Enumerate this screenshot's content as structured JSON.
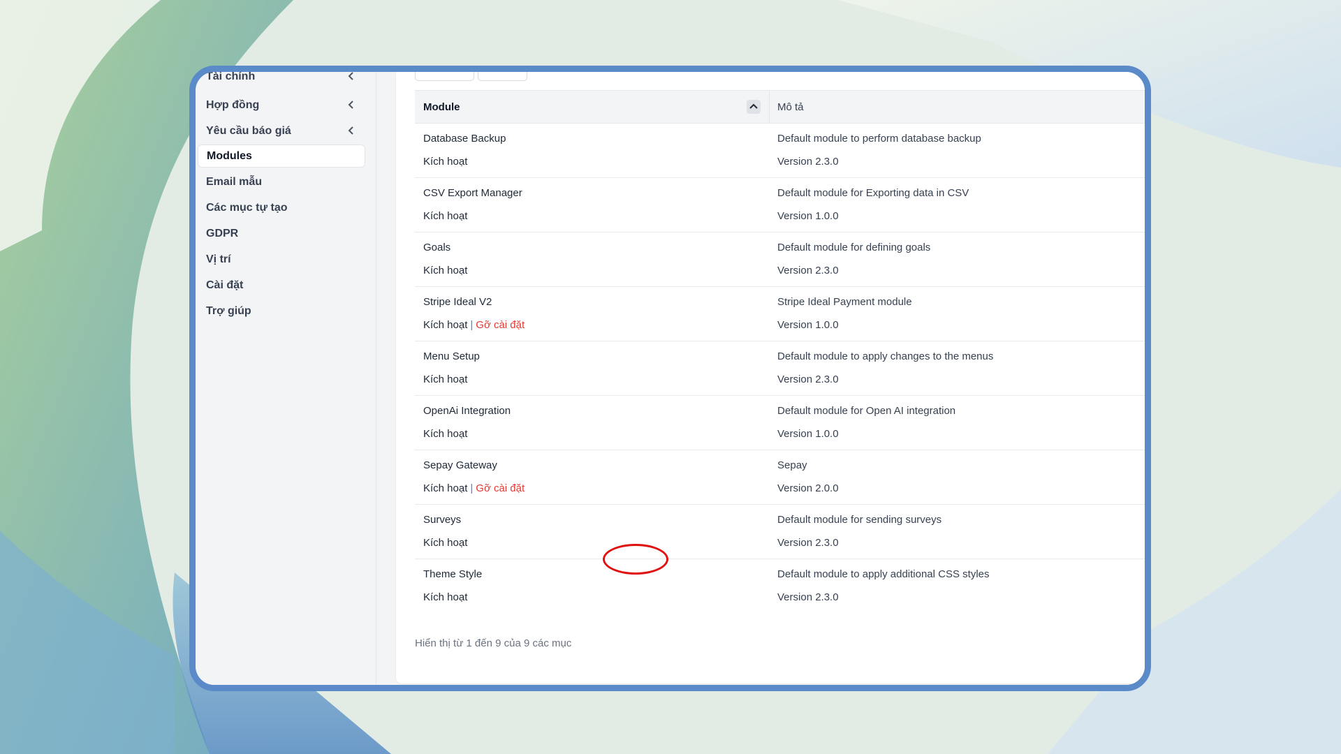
{
  "sidebar": {
    "items": [
      {
        "label": "Tài chính",
        "has_chevron": true,
        "active": false
      },
      {
        "label": "Hợp đồng",
        "has_chevron": true,
        "active": false
      },
      {
        "label": "Yêu cầu báo giá",
        "has_chevron": true,
        "active": false
      },
      {
        "label": "Modules",
        "has_chevron": false,
        "active": true
      },
      {
        "label": "Email mẫu",
        "has_chevron": false,
        "active": false
      },
      {
        "label": "Các mục tự tạo",
        "has_chevron": false,
        "active": false
      },
      {
        "label": "GDPR",
        "has_chevron": false,
        "active": false
      },
      {
        "label": "Vị trí",
        "has_chevron": false,
        "active": false
      },
      {
        "label": "Cài đặt",
        "has_chevron": false,
        "active": false
      },
      {
        "label": "Trợ giúp",
        "has_chevron": false,
        "active": false
      }
    ]
  },
  "table": {
    "headers": {
      "module": "Module",
      "description": "Mô tả"
    },
    "sort_icon": "chevron-up-icon",
    "rows": [
      {
        "name": "Database Backup",
        "activate": "Kích hoạt",
        "uninstall": "",
        "description": "Default module to perform database backup",
        "version": "Version 2.3.0"
      },
      {
        "name": "CSV Export Manager",
        "activate": "Kích hoạt",
        "uninstall": "",
        "description": "Default module for Exporting data in CSV",
        "version": "Version 1.0.0"
      },
      {
        "name": "Goals",
        "activate": "Kích hoạt",
        "uninstall": "",
        "description": "Default module for defining goals",
        "version": "Version 2.3.0"
      },
      {
        "name": "Stripe Ideal V2",
        "activate": "Kích hoạt",
        "uninstall": "Gỡ cài đặt",
        "description": "Stripe Ideal Payment module",
        "version": "Version 1.0.0"
      },
      {
        "name": "Menu Setup",
        "activate": "Kích hoạt",
        "uninstall": "",
        "description": "Default module to apply changes to the menus",
        "version": "Version 2.3.0"
      },
      {
        "name": "OpenAi Integration",
        "activate": "Kích hoạt",
        "uninstall": "",
        "description": "Default module for Open AI integration",
        "version": "Version 1.0.0"
      },
      {
        "name": "Sepay Gateway",
        "activate": "Kích hoạt",
        "uninstall": "Gỡ cài đặt",
        "description": "Sepay",
        "version": "Version 2.0.0"
      },
      {
        "name": "Surveys",
        "activate": "Kích hoạt",
        "uninstall": "",
        "description": "Default module for sending surveys",
        "version": "Version 2.3.0"
      },
      {
        "name": "Theme Style",
        "activate": "Kích hoạt",
        "uninstall": "",
        "description": "Default module to apply additional CSS styles",
        "version": "Version 2.3.0"
      }
    ],
    "footer": "Hiển thị từ 1 đến 9 của 9 các mục"
  },
  "colors": {
    "frame_border": "#5b8ac8",
    "uninstall_link": "#e53935",
    "highlight_ring": "#e01010"
  }
}
